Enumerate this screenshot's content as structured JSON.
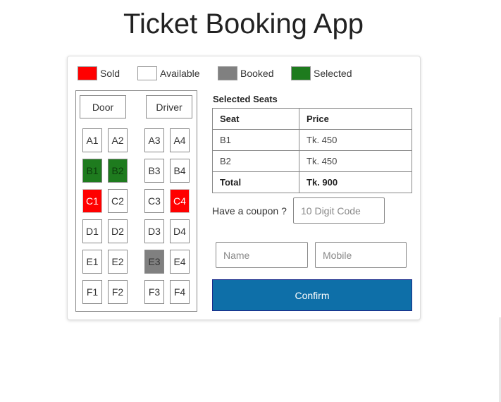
{
  "header": {
    "title": "Ticket Booking App"
  },
  "legend": [
    {
      "label": "Sold",
      "color": "#ff0000"
    },
    {
      "label": "Available",
      "color": "#ffffff"
    },
    {
      "label": "Booked",
      "color": "#808080"
    },
    {
      "label": "Selected",
      "color": "#1e7b1e"
    }
  ],
  "seat_map": {
    "door_label": "Door",
    "driver_label": "Driver",
    "seats": [
      {
        "id": "A1",
        "status": "available"
      },
      {
        "id": "A2",
        "status": "available"
      },
      {
        "id": "A3",
        "status": "available"
      },
      {
        "id": "A4",
        "status": "available"
      },
      {
        "id": "B1",
        "status": "selected"
      },
      {
        "id": "B2",
        "status": "selected"
      },
      {
        "id": "B3",
        "status": "available"
      },
      {
        "id": "B4",
        "status": "available"
      },
      {
        "id": "C1",
        "status": "sold"
      },
      {
        "id": "C2",
        "status": "available"
      },
      {
        "id": "C3",
        "status": "available"
      },
      {
        "id": "C4",
        "status": "sold"
      },
      {
        "id": "D1",
        "status": "available"
      },
      {
        "id": "D2",
        "status": "available"
      },
      {
        "id": "D3",
        "status": "available"
      },
      {
        "id": "D4",
        "status": "available"
      },
      {
        "id": "E1",
        "status": "available"
      },
      {
        "id": "E2",
        "status": "available"
      },
      {
        "id": "E3",
        "status": "booked"
      },
      {
        "id": "E4",
        "status": "available"
      },
      {
        "id": "F1",
        "status": "available"
      },
      {
        "id": "F2",
        "status": "available"
      },
      {
        "id": "F3",
        "status": "available"
      },
      {
        "id": "F4",
        "status": "available"
      }
    ]
  },
  "selected": {
    "title": "Selected Seats",
    "headers": {
      "seat": "Seat",
      "price": "Price"
    },
    "rows": [
      {
        "seat": "B1",
        "price": "Tk. 450"
      },
      {
        "seat": "B2",
        "price": "Tk. 450"
      }
    ],
    "total_label": "Total",
    "total_value": "Tk. 900"
  },
  "form": {
    "coupon_label": "Have a coupon ?",
    "coupon_placeholder": "10 Digit Code",
    "name_placeholder": "Name",
    "mobile_placeholder": "Mobile",
    "confirm_label": "Confirm"
  }
}
